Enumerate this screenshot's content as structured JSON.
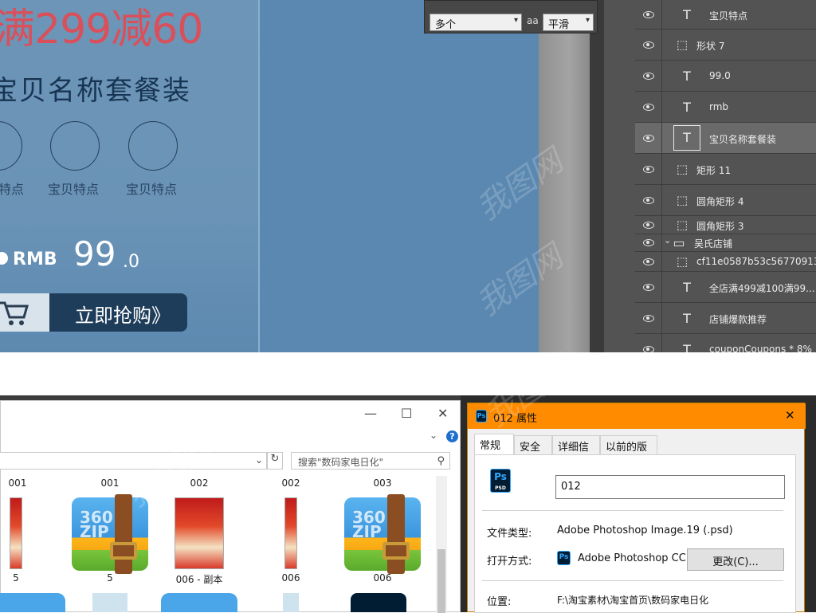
{
  "canvas": {
    "promo_title": "满299减60",
    "product_name": "宝贝名称套餐装",
    "features": [
      "特点",
      "宝贝特点",
      "宝贝特点"
    ],
    "price_rmb": "RMB",
    "price_int": "99",
    "price_dec": ".0",
    "buy_button": "立即抢购》",
    "cart_icon": "shopping-cart-icon"
  },
  "options_bar": {
    "antialias_select": "多个",
    "aa_icon": "aa",
    "smoothing_select": "平滑"
  },
  "layers": [
    {
      "type": "text",
      "name": "宝贝特点",
      "selected": false
    },
    {
      "type": "shape",
      "name": "形状 7",
      "selected": false
    },
    {
      "type": "text",
      "name": "99.0",
      "selected": false
    },
    {
      "type": "text",
      "name": "rmb",
      "selected": false
    },
    {
      "type": "text",
      "name": "宝贝名称套餐装",
      "selected": true
    },
    {
      "type": "shape",
      "name": "矩形 11",
      "selected": false
    },
    {
      "type": "shape",
      "name": "圆角矩形 4",
      "selected": false
    },
    {
      "type": "smart",
      "name": "圆角矩形 3",
      "selected": false
    },
    {
      "type": "folder",
      "name": "吴氏店铺",
      "selected": false
    },
    {
      "type": "smart",
      "name": "cf11e0587b53c56770913...",
      "selected": false
    },
    {
      "type": "text",
      "name": "全店满499减100满99...",
      "selected": false
    },
    {
      "type": "text",
      "name": "店铺爆款推荐",
      "selected": false
    },
    {
      "type": "text",
      "name": "couponCoupons * 8% ...",
      "selected": false
    }
  ],
  "explorer": {
    "search_placeholder": "搜索\"数码家电日化\"",
    "help": "?",
    "minimize": "—",
    "maximize": "☐",
    "close": "✕",
    "refresh": "↻",
    "top_labels": [
      "001",
      "001",
      "002",
      "002",
      "003"
    ],
    "items": [
      {
        "label": "5",
        "kind": "thumb"
      },
      {
        "label": "5",
        "kind": "zip"
      },
      {
        "label": "006 - 副本",
        "kind": "thumb"
      },
      {
        "label": "006",
        "kind": "thumb"
      },
      {
        "label": "006",
        "kind": "zip"
      }
    ],
    "zip_text": "360\nZIP"
  },
  "properties": {
    "title": "012 属性",
    "tabs": [
      "常规",
      "安全",
      "详细信息",
      "以前的版本"
    ],
    "file_name": "012",
    "file_type_label": "文件类型:",
    "file_type_value": "Adobe Photoshop Image.19 (.psd)",
    "open_with_label": "打开方式:",
    "open_with_value": "Adobe Photoshop CC",
    "change_button": "更改(C)...",
    "location_label": "位置:",
    "location_value": "F:\\淘宝素材\\淘宝首页\\数码家电日化",
    "ps_icon_text": "Ps",
    "psd_badge": "PSD",
    "close": "✕"
  },
  "watermark": "我图网"
}
